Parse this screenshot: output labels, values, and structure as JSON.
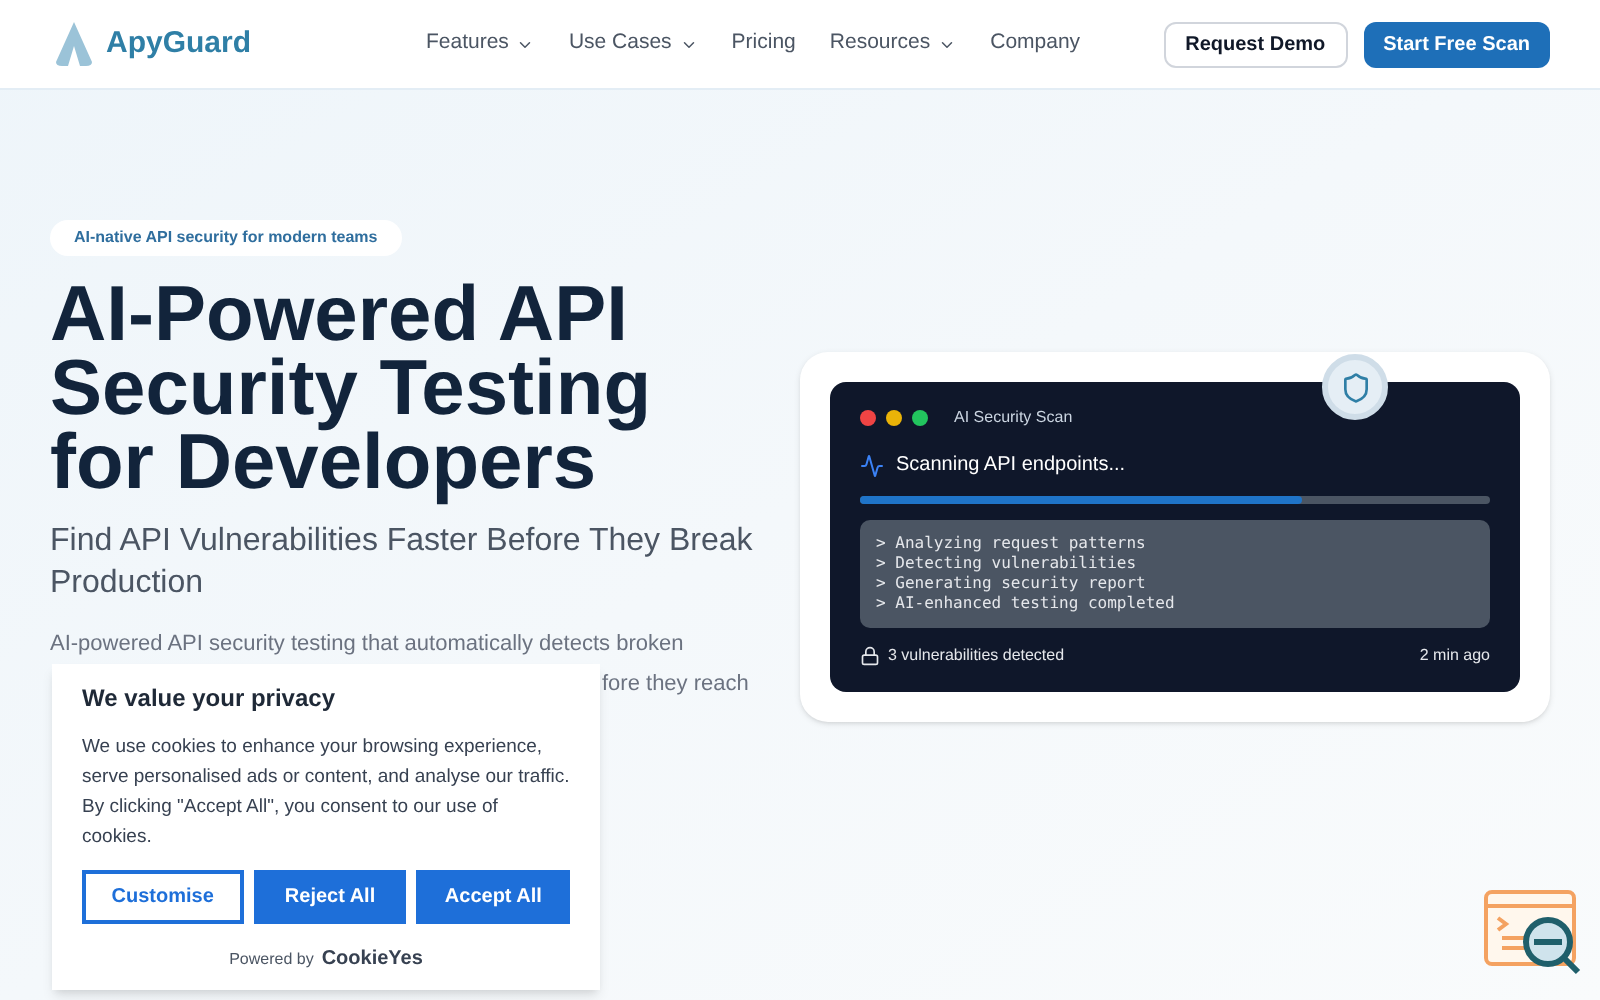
{
  "nav": {
    "logo": "ApyGuard",
    "links": [
      {
        "label": "Features",
        "dropdown": true
      },
      {
        "label": "Use Cases",
        "dropdown": true
      },
      {
        "label": "Pricing",
        "dropdown": false
      },
      {
        "label": "Resources",
        "dropdown": true
      },
      {
        "label": "Company",
        "dropdown": false
      }
    ],
    "buttons": [
      {
        "label": "Request Demo",
        "kind": "outline"
      },
      {
        "label": "Start Free Scan",
        "kind": "primary"
      }
    ]
  },
  "hero": {
    "badge": "AI-native API security for modern teams",
    "title_lines": [
      "AI-Powered API",
      "Security Testing",
      "for Developers"
    ],
    "subtitle": "Find API Vulnerabilities Faster Before They Break Production",
    "paragraph_visible": [
      "AI-powered API security testing that automatically detects broken",
      "fore they reach"
    ]
  },
  "scan_card": {
    "window_dots": [
      {
        "color": "#ef4444"
      },
      {
        "color": "#eab308"
      },
      {
        "color": "#22c55e"
      }
    ],
    "title": "AI Security Scan",
    "status": "Scanning API endpoints...",
    "level": 0.7,
    "log": [
      "> Analyzing request patterns",
      "> Detecting vulnerabilities",
      "> Generating security report",
      "> AI-enhanced testing completed"
    ],
    "footer_left": "3 vulnerabilities detected",
    "footer_right": "2 min ago"
  },
  "cookie_banner": {
    "title": "We value your privacy",
    "text": "We use cookies to enhance your browsing experience, serve personalised ads or content, and analyse our traffic. By clicking \"Accept All\", you consent to our use of cookies.",
    "buttons": [
      {
        "label": "Customise",
        "kind": "outline"
      },
      {
        "label": "Reject All",
        "kind": "primary"
      },
      {
        "label": "Accept All",
        "kind": "primary"
      }
    ],
    "powered_by": "Powered by",
    "brand": "CookieYes"
  }
}
